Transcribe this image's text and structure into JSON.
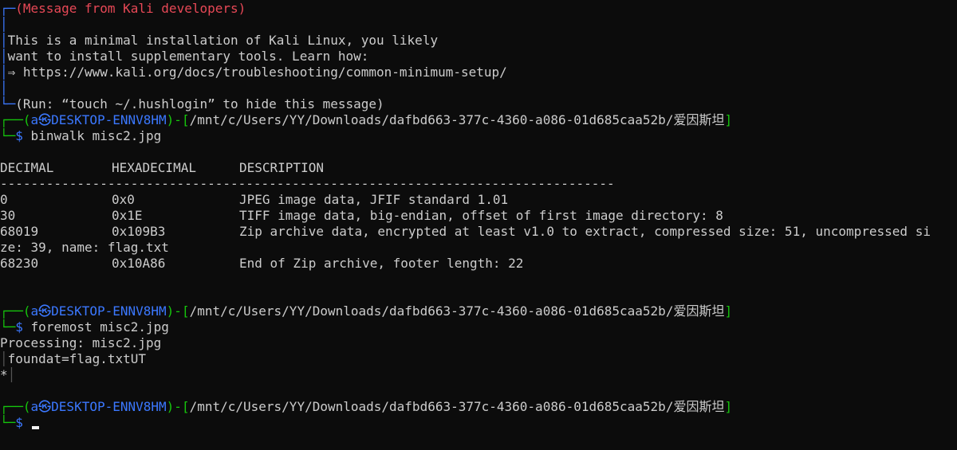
{
  "motd": {
    "title": "Message from Kali developers",
    "body_line1": "This is a minimal installation of Kali Linux, you likely",
    "body_line2": "want to install supplementary tools. Learn how:",
    "body_line3": "⇒ https://www.kali.org/docs/troubleshooting/common-minimum-setup/",
    "footer": "Run: “touch ~/.hushlogin” to hide this message"
  },
  "prompt": {
    "user_host": "a㉿DESKTOP-ENNV8HM",
    "path": "/mnt/c/Users/YY/Downloads/dafbd663-377c-4360-a086-01d685caa52b/爱因斯坦",
    "symbol": "$"
  },
  "commands": {
    "binwalk": "binwalk misc2.jpg",
    "foremost": "foremost misc2.jpg"
  },
  "binwalk_table": {
    "headers": [
      "DECIMAL",
      "HEXADECIMAL",
      "DESCRIPTION"
    ],
    "separator": "--------------------------------------------------------------------------------",
    "rows": [
      {
        "decimal": "0",
        "hex": "0x0",
        "desc": "JPEG image data, JFIF standard 1.01"
      },
      {
        "decimal": "30",
        "hex": "0x1E",
        "desc": "TIFF image data, big-endian, offset of first image directory: 8"
      },
      {
        "decimal": "68019",
        "hex": "0x109B3",
        "desc": "Zip archive data, encrypted at least v1.0 to extract, compressed size: 51, uncompressed si"
      },
      {
        "decimal": "68230",
        "hex": "0x10A86",
        "desc": "End of Zip archive, footer length: 22"
      }
    ],
    "wrap_line": "ze: 39, name: flag.txt"
  },
  "foremost_output": {
    "processing": "Processing: misc2.jpg",
    "foundat": "foundat=flag.txtUT",
    "star": "*"
  },
  "colors": {
    "background": "#0c0c0c",
    "text": "#cccccc",
    "prompt_frame": "#16c60c",
    "user_host": "#3b78ff",
    "motd_title": "#e74856"
  }
}
